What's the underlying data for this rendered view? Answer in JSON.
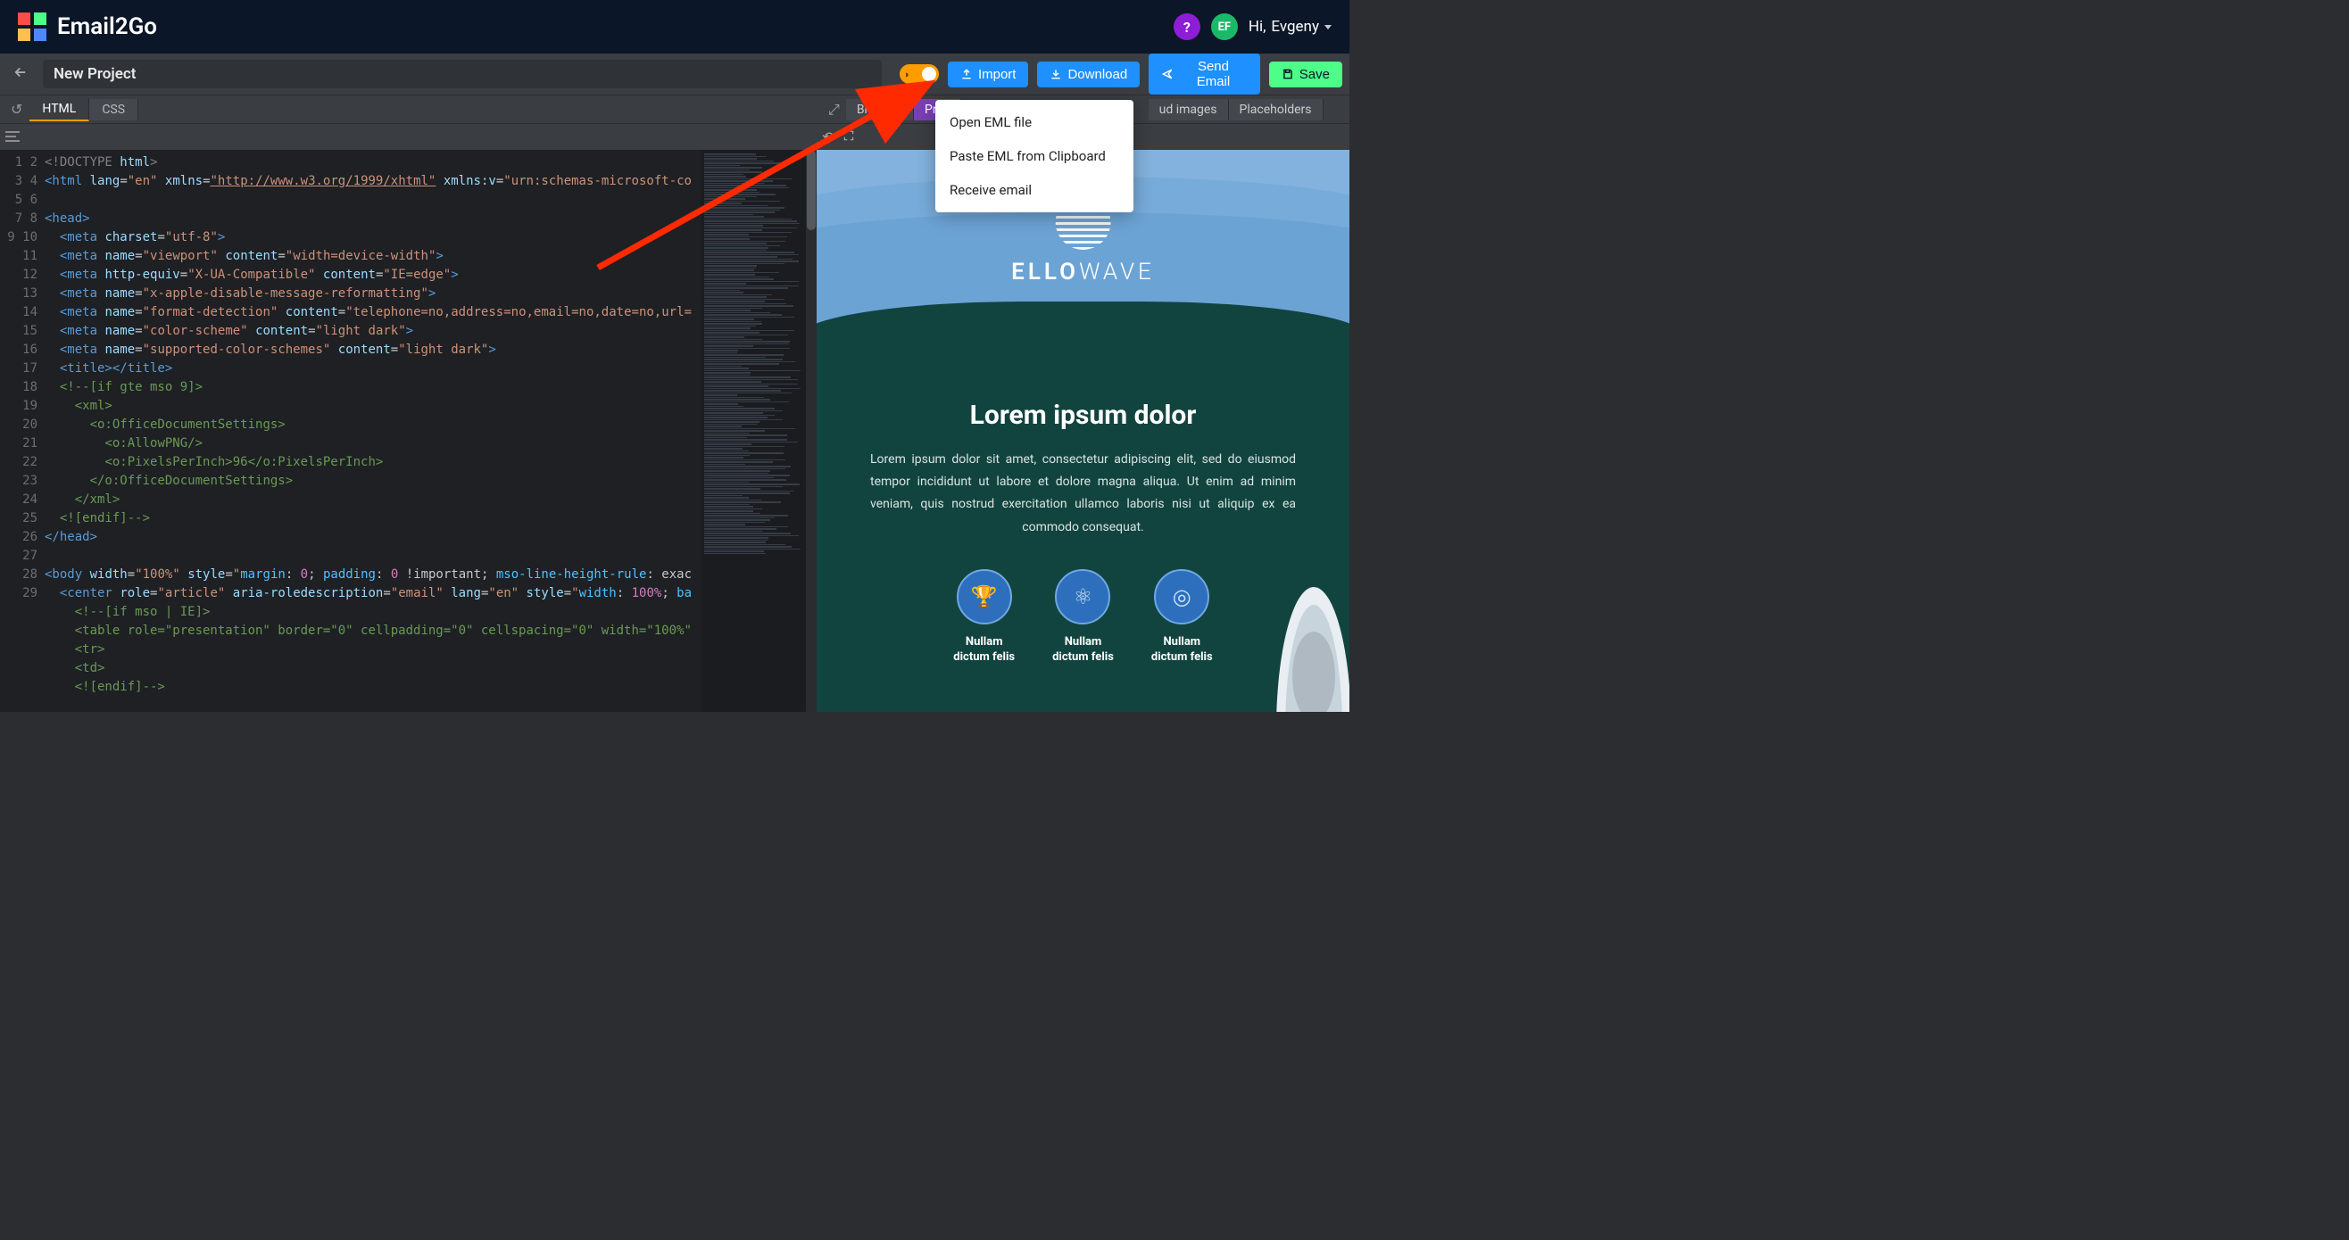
{
  "brand": "Email2Go",
  "user": {
    "name": "Evgeny",
    "initials": "EF",
    "greeting_prefix": "Hi,"
  },
  "project_name": "New Project",
  "toolbar": {
    "import": "Import",
    "download": "Download",
    "send": "Send Email",
    "save": "Save"
  },
  "import_menu": {
    "items": [
      "Open EML file",
      "Paste EML from Clipboard",
      "Receive email"
    ]
  },
  "left_tabs": {
    "html": "HTML",
    "css": "CSS"
  },
  "right_tabs": {
    "browser": "Browser",
    "preview": "Prev",
    "cloud": "ud images",
    "placeholders": "Placeholders"
  },
  "code_lines": [
    {
      "n": 1,
      "html": "<span class='tok-decl'>&lt;!DOCTYPE</span> <span class='tok-attr'>html</span><span class='tok-decl'>&gt;</span>"
    },
    {
      "n": 2,
      "html": "<span class='tok-tag'>&lt;html</span> <span class='tok-attr'>lang</span>=<span class='tok-str'>\"en\"</span> <span class='tok-attr'>xmlns</span>=<span class='tok-str tok-underline'>\"http://www.w3.org/1999/xhtml\"</span> <span class='tok-attr'>xmlns:v</span>=<span class='tok-str'>\"urn:schemas-microsoft-co</span>"
    },
    {
      "n": 3,
      "html": ""
    },
    {
      "n": 4,
      "html": "<span class='tok-tag'>&lt;head&gt;</span>"
    },
    {
      "n": 5,
      "html": "  <span class='tok-tag'>&lt;meta</span> <span class='tok-attr'>charset</span>=<span class='tok-str'>\"utf-8\"</span><span class='tok-tag'>&gt;</span>"
    },
    {
      "n": 6,
      "html": "  <span class='tok-tag'>&lt;meta</span> <span class='tok-attr'>name</span>=<span class='tok-str'>\"viewport\"</span> <span class='tok-attr'>content</span>=<span class='tok-str'>\"width=device-width\"</span><span class='tok-tag'>&gt;</span>"
    },
    {
      "n": 7,
      "html": "  <span class='tok-tag'>&lt;meta</span> <span class='tok-attr'>http-equiv</span>=<span class='tok-str'>\"X-UA-Compatible\"</span> <span class='tok-attr'>content</span>=<span class='tok-str'>\"IE=edge\"</span><span class='tok-tag'>&gt;</span>"
    },
    {
      "n": 8,
      "html": "  <span class='tok-tag'>&lt;meta</span> <span class='tok-attr'>name</span>=<span class='tok-str'>\"x-apple-disable-message-reformatting\"</span><span class='tok-tag'>&gt;</span>"
    },
    {
      "n": 9,
      "html": "  <span class='tok-tag'>&lt;meta</span> <span class='tok-attr'>name</span>=<span class='tok-str'>\"format-detection\"</span> <span class='tok-attr'>content</span>=<span class='tok-str'>\"telephone=no,address=no,email=no,date=no,url=</span>"
    },
    {
      "n": 10,
      "html": "  <span class='tok-tag'>&lt;meta</span> <span class='tok-attr'>name</span>=<span class='tok-str'>\"color-scheme\"</span> <span class='tok-attr'>content</span>=<span class='tok-str'>\"light dark\"</span><span class='tok-tag'>&gt;</span>"
    },
    {
      "n": 11,
      "html": "  <span class='tok-tag'>&lt;meta</span> <span class='tok-attr'>name</span>=<span class='tok-str'>\"supported-color-schemes\"</span> <span class='tok-attr'>content</span>=<span class='tok-str'>\"light dark\"</span><span class='tok-tag'>&gt;</span>"
    },
    {
      "n": 12,
      "html": "  <span class='tok-tag'>&lt;title&gt;&lt;/title&gt;</span>"
    },
    {
      "n": 13,
      "html": "  <span class='tok-com'>&lt;!--[if gte mso 9]&gt;</span>"
    },
    {
      "n": 14,
      "html": "    <span class='tok-com'>&lt;xml&gt;</span>"
    },
    {
      "n": 15,
      "html": "      <span class='tok-com'>&lt;o:OfficeDocumentSettings&gt;</span>"
    },
    {
      "n": 16,
      "html": "        <span class='tok-com'>&lt;o:AllowPNG/&gt;</span>"
    },
    {
      "n": 17,
      "html": "        <span class='tok-com'>&lt;o:PixelsPerInch&gt;96&lt;/o:PixelsPerInch&gt;</span>"
    },
    {
      "n": 18,
      "html": "      <span class='tok-com'>&lt;/o:OfficeDocumentSettings&gt;</span>"
    },
    {
      "n": 19,
      "html": "    <span class='tok-com'>&lt;/xml&gt;</span>"
    },
    {
      "n": 20,
      "html": "  <span class='tok-com'>&lt;![endif]--&gt;</span>"
    },
    {
      "n": 21,
      "html": "<span class='tok-tag'>&lt;/head&gt;</span>"
    },
    {
      "n": 22,
      "html": ""
    },
    {
      "n": 23,
      "html": "<span class='tok-tag'>&lt;body</span> <span class='tok-attr'>width</span>=<span class='tok-str'>\"100%\"</span> <span class='tok-attr'>style</span>=<span class='tok-str'>\"</span><span class='tok-cyan'>margin</span>: <span class='tok-pink'>0</span>; <span class='tok-cyan'>padding</span>: <span class='tok-pink'>0</span> !important; <span class='tok-cyan'>mso-line-height-rule</span>: exac"
    },
    {
      "n": 24,
      "html": "  <span class='tok-tag'>&lt;center</span> <span class='tok-attr'>role</span>=<span class='tok-str'>\"article\"</span> <span class='tok-attr'>aria-roledescription</span>=<span class='tok-str'>\"email\"</span> <span class='tok-attr'>lang</span>=<span class='tok-str'>\"en\"</span> <span class='tok-attr'>style</span>=<span class='tok-str'>\"</span><span class='tok-cyan'>width</span>: <span class='tok-pink'>100%</span>; <span class='tok-cyan'>ba</span>"
    },
    {
      "n": 25,
      "html": "    <span class='tok-com'>&lt;!--[if mso | IE]&gt;</span>"
    },
    {
      "n": 26,
      "html": "    <span class='tok-com'>&lt;table role=\"presentation\" border=\"0\" cellpadding=\"0\" cellspacing=\"0\" width=\"100%\"</span>"
    },
    {
      "n": 27,
      "html": "    <span class='tok-com'>&lt;tr&gt;</span>"
    },
    {
      "n": 28,
      "html": "    <span class='tok-com'>&lt;td&gt;</span>"
    },
    {
      "n": 29,
      "html": "    <span class='tok-com'>&lt;![endif]--&gt;</span>"
    }
  ],
  "preview": {
    "brand_a": "ELLO",
    "brand_b": "WAVE",
    "heading": "Lorem ipsum dolor",
    "body": "Lorem ipsum dolor sit amet, consectetur adipiscing elit, sed do eiusmod tempor incididunt ut labore et dolore magna aliqua. Ut enim ad minim veniam, quis nostrud exercitation ullamco laboris nisi ut aliquip ex ea commodo consequat.",
    "features": [
      {
        "icon": "🏆",
        "label_1": "Nullam",
        "label_2": "dictum felis"
      },
      {
        "icon": "⚛",
        "label_1": "Nullam",
        "label_2": "dictum felis"
      },
      {
        "icon": "◎",
        "label_1": "Nullam",
        "label_2": "dictum felis"
      }
    ]
  }
}
